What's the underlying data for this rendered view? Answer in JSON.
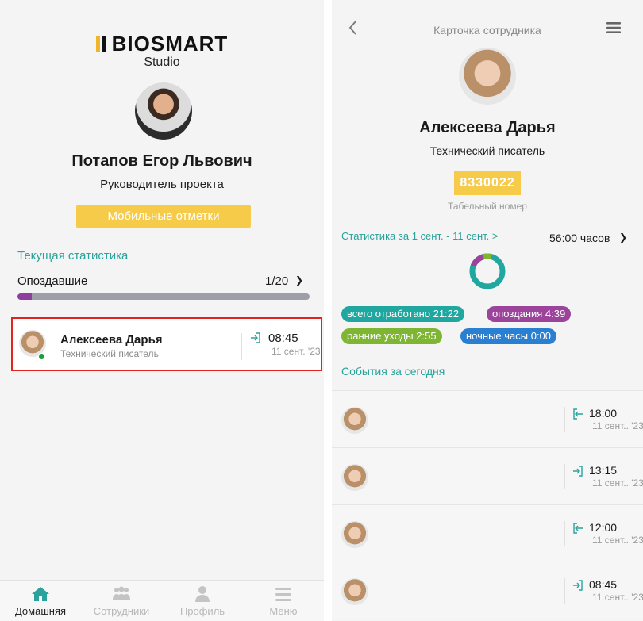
{
  "left": {
    "logo_text": "BIOSMART",
    "logo_sub": "Studio",
    "avatar_icon": "user-photo",
    "user_name": "Потапов Егор  Львович",
    "user_role": "Руководитель проекта",
    "mobile_button": "Мобильные отметки",
    "stats_link": "Текущая статистика",
    "late_label": "Опоздавшие",
    "late_count": "1/20",
    "late_fraction": 0.05,
    "employee": {
      "name": "Алексеева  Дарья",
      "role": "Технический писатель",
      "time": "08:45",
      "date": "11 сент. '23",
      "status_color": "#1d9c3b"
    },
    "nav": [
      {
        "label": "Домашняя",
        "icon": "home-icon",
        "active": true
      },
      {
        "label": "Сотрудники",
        "icon": "users-icon",
        "active": false
      },
      {
        "label": "Профиль",
        "icon": "profile-icon",
        "active": false
      },
      {
        "label": "Меню",
        "icon": "menu-icon",
        "active": false
      }
    ]
  },
  "right": {
    "title": "Карточка сотрудника",
    "name": "Алексеева  Дарья",
    "role": "Технический писатель",
    "badge_number": "8330022",
    "badge_label": "Табельный номер",
    "stats_link": "Статистика за 1 сент. - 11 сент. >",
    "hours": "56:00 часов",
    "chips": {
      "total": "всего отработано 21:22",
      "late": "опоздания 4:39",
      "early": "ранние уходы 2:55",
      "night": "ночные часы 0:00"
    },
    "events_title": "События за сегодня",
    "events": [
      {
        "time": "18:00",
        "date": "11 сент.. '23",
        "type": "exit"
      },
      {
        "time": "13:15",
        "date": "11 сент.. '23",
        "type": "entry"
      },
      {
        "time": "12:00",
        "date": "11 сент.. '23",
        "type": "exit"
      },
      {
        "time": "08:45",
        "date": "11 сент.. '23",
        "type": "entry"
      }
    ]
  },
  "colors": {
    "accent": "#29a39b",
    "brand_yellow": "#f6cb4a",
    "highlight_border": "#e1241f"
  }
}
